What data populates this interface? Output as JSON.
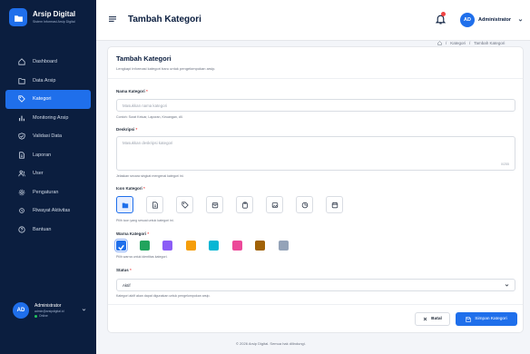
{
  "brand": {
    "name": "Arsip Digital",
    "subtitle": "Sistem Informasi Arsip Digital"
  },
  "sidebar": {
    "items": [
      {
        "label": "Dashboard",
        "icon": "home-icon"
      },
      {
        "label": "Data Arsip",
        "icon": "folder-icon"
      },
      {
        "label": "Kategori",
        "icon": "tag-icon",
        "active": true
      },
      {
        "label": "Monitoring Arsip",
        "icon": "bar-chart-icon"
      },
      {
        "label": "Validasi Data",
        "icon": "check-shield-icon"
      },
      {
        "label": "Laporan",
        "icon": "file-icon"
      },
      {
        "label": "User",
        "icon": "users-icon"
      },
      {
        "label": "Pengaturan",
        "icon": "gear-icon"
      },
      {
        "label": "Riwayat Aktivitas",
        "icon": "history-icon"
      },
      {
        "label": "Bantuan",
        "icon": "help-icon"
      }
    ],
    "user": {
      "initials": "AD",
      "name": "Administrator",
      "email": "admin@arsipdigital.id",
      "status": "Online"
    }
  },
  "topbar": {
    "title": "Tambah Kategori",
    "user_initials": "AD",
    "user_name": "Administrator"
  },
  "breadcrumb": {
    "sep": "/",
    "parent": "Kategori",
    "current": "Tambah Kategori"
  },
  "form": {
    "title": "Tambah Kategori",
    "subtitle": "Lengkapi informasi kategori baru untuk pengelompokan arsip.",
    "name": {
      "label": "Nama Kategori",
      "required": "*",
      "placeholder": "Masukkan nama kategori",
      "help": "Contoh: Surat Keluar, Laporan, Keuangan, dll."
    },
    "desc": {
      "label": "Deskripsi",
      "required": "*",
      "placeholder": "Masukkan deskripsi kategori",
      "counter": "0/255",
      "help": "Jelaskan secara singkat mengenai kategori ini."
    },
    "icon": {
      "label": "Icon Kategori",
      "required": "*",
      "help": "Pilih icon yang sesuai untuk kategori ini.",
      "options": [
        "folder-icon",
        "file-icon",
        "tag-icon",
        "box-icon",
        "clipboard-icon",
        "image-icon",
        "pie-chart-icon",
        "calendar-icon"
      ],
      "selected": 0
    },
    "color": {
      "label": "Warna Kategori",
      "required": "*",
      "help": "Pilih warna untuk identitas kategori.",
      "options": [
        "#1f6feb",
        "#22a45d",
        "#8b5cf6",
        "#f59e0b",
        "#06b6d4",
        "#ec4899",
        "#a16207",
        "#94a3b8"
      ],
      "selected": 0
    },
    "status": {
      "label": "Status",
      "required": "*",
      "value": "Aktif",
      "help": "Kategori aktif akan dapat digunakan untuk pengelompokan arsip."
    },
    "cancel_label": "Batal",
    "save_label": "Simpan Kategori"
  },
  "footer": {
    "text": "© 2026 Arsip Digital. Semua hak dilindungi."
  }
}
